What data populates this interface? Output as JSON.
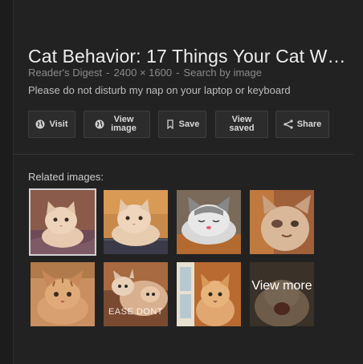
{
  "title": "Cat Behavior: 17 Things Your Cat W…",
  "meta": {
    "source": "Reader's Digest",
    "separator": "-",
    "dimensions": "2400 × 1600",
    "search_by_image": "Search by image"
  },
  "description": "Please do not disturb my nap on your laptop or keyboard",
  "buttons": {
    "visit": {
      "label": "Visit",
      "icon": "globe-icon"
    },
    "view_image": {
      "label": "View image",
      "icon": "globe-icon"
    },
    "save": {
      "label": "Save",
      "icon": "bookmark-icon"
    },
    "view_saved": {
      "label": "View saved"
    },
    "share": {
      "label": "Share",
      "icon": "share-icon"
    }
  },
  "related": {
    "heading": "Related images:",
    "thumbnails": [
      {
        "subject": "cream kitten on blanket",
        "selected": true
      },
      {
        "subject": "cream kitten on blanket"
      },
      {
        "subject": "sleeping gray and white kitten"
      },
      {
        "subject": "kitten with injured eye"
      },
      {
        "subject": "orange tabby kitten"
      },
      {
        "subject": "kittens playing",
        "caption": "EASE DONT"
      },
      {
        "subject": "cat by window"
      }
    ],
    "view_more_label": "View more"
  },
  "colors": {
    "background": "#222222",
    "button_bg": "#2c2c2c",
    "text_primary": "#eeeeee",
    "text_secondary": "#8a8a8a"
  }
}
